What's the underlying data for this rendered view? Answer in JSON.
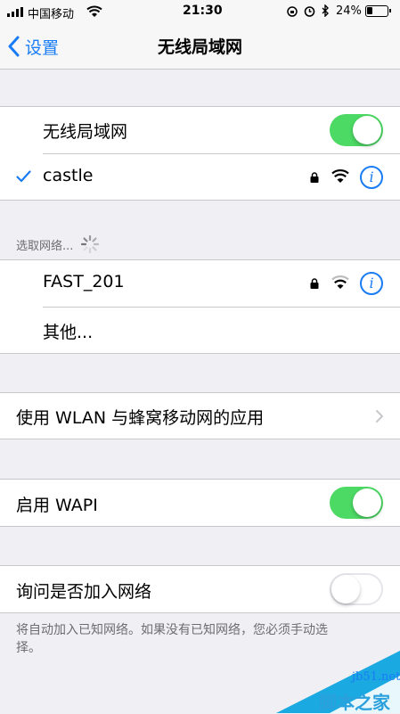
{
  "status": {
    "carrier": "中国移动",
    "time": "21:30",
    "battery": "24%"
  },
  "nav": {
    "back_label": "设置",
    "title": "无线局域网"
  },
  "wifi": {
    "label": "无线局域网",
    "enabled": true,
    "connected_network": "castle"
  },
  "choose_header": "选取网络...",
  "networks": [
    {
      "name": "FAST_201"
    },
    {
      "name": "其他..."
    }
  ],
  "wlan_apps_label": "使用 WLAN 与蜂窝移动网的应用",
  "wapi": {
    "label": "启用 WAPI",
    "enabled": true
  },
  "ask_join": {
    "label": "询问是否加入网络",
    "enabled": false
  },
  "footnote": "将自动加入已知网络。如果没有已知网络，您必须手动选择。",
  "watermark": {
    "url": "jb51.net",
    "name": "脚本之家"
  },
  "colors": {
    "accent": "#1a7cf5",
    "toggle_on": "#4cd964",
    "background": "#efeff4"
  },
  "icons": [
    "signal-bars-icon",
    "wifi-icon",
    "lock-icon",
    "alarm-icon",
    "bluetooth-icon",
    "battery-icon",
    "info-icon",
    "checkmark-icon",
    "chevron-right-icon",
    "spinner-icon"
  ]
}
